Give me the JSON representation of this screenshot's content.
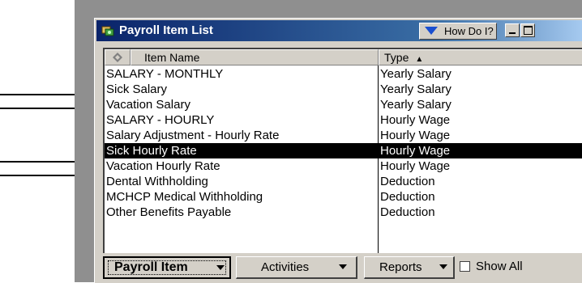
{
  "window": {
    "title": "Payroll Item List",
    "how_do_i": "How Do I?"
  },
  "columns": {
    "name_header": "Item Name",
    "type_header": "Type"
  },
  "items": [
    {
      "name": "SALARY - MONTHLY",
      "type": "Yearly Salary",
      "selected": false
    },
    {
      "name": "Sick Salary",
      "type": "Yearly Salary",
      "selected": false
    },
    {
      "name": "Vacation Salary",
      "type": "Yearly Salary",
      "selected": false
    },
    {
      "name": "SALARY - HOURLY",
      "type": "Hourly Wage",
      "selected": false
    },
    {
      "name": "Salary Adjustment - Hourly Rate",
      "type": "Hourly Wage",
      "selected": false
    },
    {
      "name": "Sick Hourly Rate",
      "type": "Hourly Wage",
      "selected": true
    },
    {
      "name": "Vacation Hourly Rate",
      "type": "Hourly Wage",
      "selected": false
    },
    {
      "name": "Dental Withholding",
      "type": "Deduction",
      "selected": false
    },
    {
      "name": "MCHCP Medical Withholding",
      "type": "Deduction",
      "selected": false
    },
    {
      "name": "Other Benefits Payable",
      "type": "Deduction",
      "selected": false
    }
  ],
  "buttons": {
    "payroll_item": "Payroll Item",
    "activities": "Activities",
    "reports": "Reports",
    "show_all": "Show All",
    "show_all_checked": false
  },
  "sort_direction": "ascending",
  "annotation_arrows_point_to": [
    "Sick Salary",
    "Vacation Salary",
    "Sick Hourly Rate",
    "Vacation Hourly Rate"
  ],
  "colors": {
    "titlebar_start": "#0a246a",
    "titlebar_end": "#a6caf0",
    "selection_bg": "#000000",
    "chrome": "#d4d0c8"
  },
  "icons": {
    "app": "payroll-app-icon",
    "how_do_i": "triangle-down-icon",
    "minimize": "minimize-icon",
    "maximize": "maximize-icon",
    "header": "diamond-icon",
    "sort": "sort-ascending-icon",
    "dropdown": "dropdown-arrow-icon",
    "checkbox": "checkbox-icon"
  }
}
